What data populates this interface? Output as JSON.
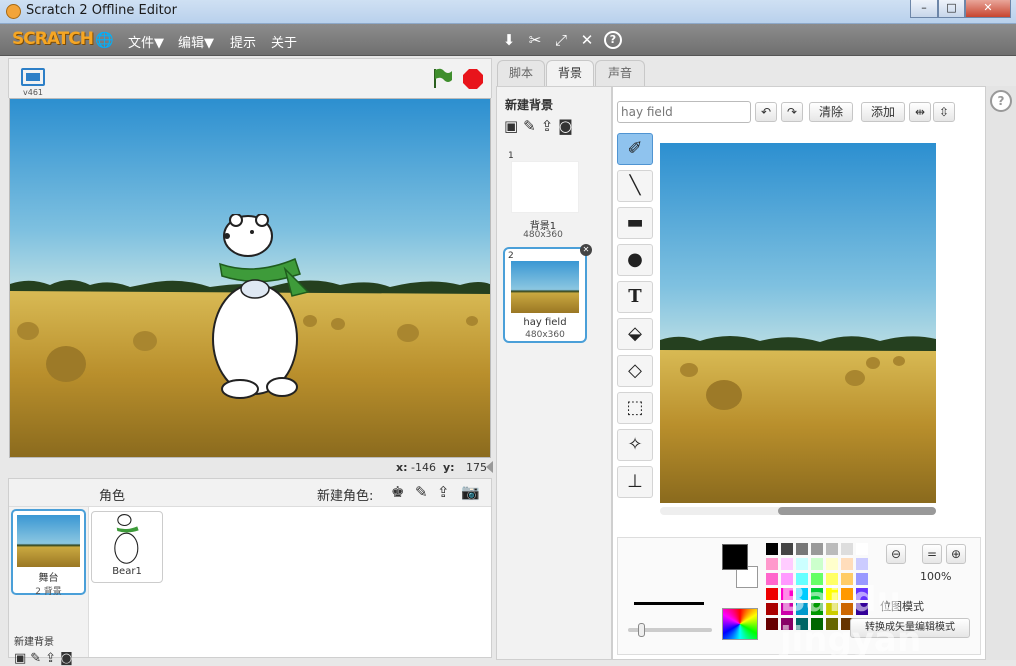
{
  "window": {
    "title": "Scratch 2 Offline Editor",
    "min": "–",
    "max": "□",
    "close": "✕"
  },
  "menubar": {
    "logo": "SCRATCH",
    "items": [
      {
        "label": "文件▼"
      },
      {
        "label": "编辑▼"
      },
      {
        "label": "提示"
      },
      {
        "label": "关于"
      }
    ],
    "tool_icons": [
      "stamp-icon",
      "cut-icon",
      "grow-icon",
      "shrink-icon",
      "help-icon"
    ]
  },
  "stage": {
    "version": "v461",
    "coords": {
      "x_label": "x:",
      "x": "-146",
      "y_label": "y:",
      "y": "175"
    }
  },
  "sprites_panel": {
    "title": "角色",
    "new_sprite_label": "新建角色:",
    "stage_item": {
      "name": "舞台",
      "sub": "2 背景"
    },
    "new_backdrop_label": "新建背景",
    "sprites": [
      {
        "name": "Bear1"
      }
    ]
  },
  "tabs": [
    {
      "label": "脚本"
    },
    {
      "label": "背景"
    },
    {
      "label": "声音"
    }
  ],
  "backdrops": {
    "new_label": "新建背景",
    "items": [
      {
        "index": "1",
        "name": "背景1",
        "size": "480x360"
      },
      {
        "index": "2",
        "name": "hay field",
        "size": "480x360"
      }
    ]
  },
  "paint_editor": {
    "costume_name": "hay field",
    "clear_label": "清除",
    "add_label": "添加",
    "zoom": "100%",
    "mode_label": "位图模式",
    "convert_label": "转换成矢量编辑模式",
    "tools": [
      "brush-icon",
      "line-icon",
      "rectangle-icon",
      "ellipse-icon",
      "text-icon",
      "fill-icon",
      "eraser-icon",
      "select-icon",
      "magic-select-icon",
      "stamp-icon"
    ]
  },
  "watermark": {
    "text": "Bai du jingyan"
  },
  "colors": {
    "selected": "#4a9fd8",
    "stop": "#e8141b",
    "flag": "#3f8e2d"
  }
}
